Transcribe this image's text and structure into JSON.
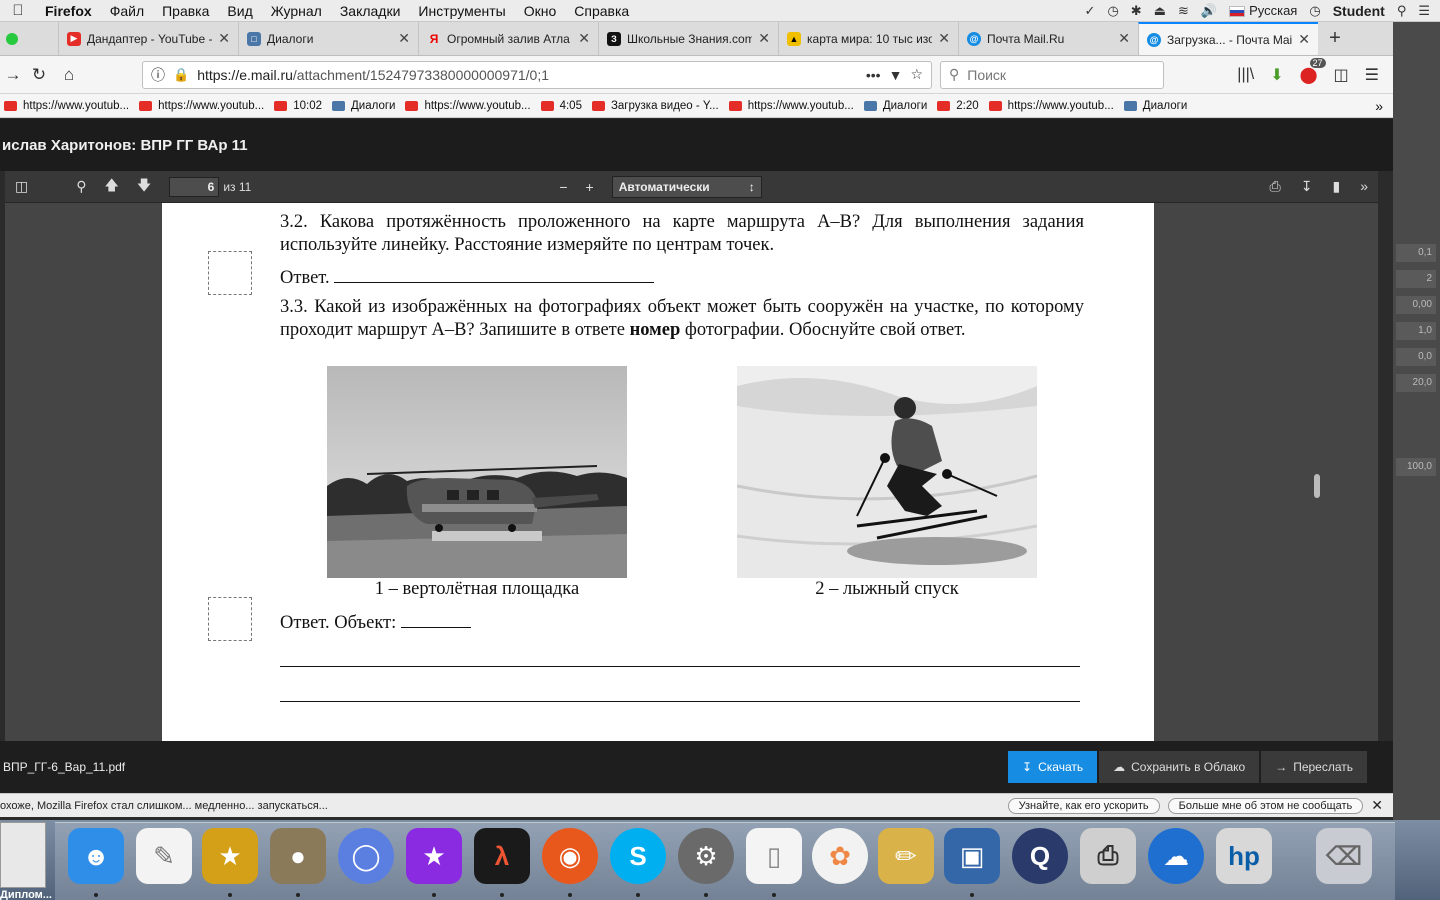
{
  "menubar": {
    "app": "Firefox",
    "items": [
      "Файл",
      "Правка",
      "Вид",
      "Журнал",
      "Закладки",
      "Инструменты",
      "Окно",
      "Справка"
    ],
    "language": "Русская",
    "user": "Student"
  },
  "tabs": [
    {
      "label": "Дандаптер - YouTube -",
      "icon": "youtube-icon"
    },
    {
      "label": "Диалоги",
      "icon": "vk-icon"
    },
    {
      "label": "Огромный залив Атла",
      "icon": "yandex-icon"
    },
    {
      "label": "Школьные Знания.com",
      "icon": "znania-icon"
    },
    {
      "label": "карта мира: 10 тыс изо",
      "icon": "image-icon"
    },
    {
      "label": "Почта Mail.Ru",
      "icon": "mail-icon"
    },
    {
      "label": "Загрузка... - Почта Mai",
      "icon": "mail-icon"
    }
  ],
  "url": {
    "host": "https://e.mail.ru",
    "path": "/attachment/15247973380000000971/0;1"
  },
  "search_placeholder": "Поиск",
  "library_badge": "27",
  "bookmarks": [
    {
      "label": "https://www.youtub...",
      "icon": "yt"
    },
    {
      "label": "https://www.youtub...",
      "icon": "yt"
    },
    {
      "label": "10:02",
      "icon": "yt"
    },
    {
      "label": "Диалоги",
      "icon": "vk"
    },
    {
      "label": "https://www.youtub...",
      "icon": "yt"
    },
    {
      "label": "4:05",
      "icon": "yt"
    },
    {
      "label": "Загрузка видео - Y...",
      "icon": "yt"
    },
    {
      "label": "https://www.youtub...",
      "icon": "yt"
    },
    {
      "label": "Диалоги",
      "icon": "vk"
    },
    {
      "label": "2:20",
      "icon": "yt"
    },
    {
      "label": "https://www.youtub...",
      "icon": "yt"
    },
    {
      "label": "Диалоги",
      "icon": "vk"
    }
  ],
  "attachment_title": "ислав Харитонов: ВПР ГГ ВАр 11",
  "viewer": {
    "page": "6",
    "page_count": "из 11",
    "zoom": "Автоматически"
  },
  "document": {
    "q32": "3.2. Какова протяжённость проложенного на карте маршрута А–В? Для выполнения задания используйте линейку. Расстояние измеряйте по центрам точек.",
    "answer1": "Ответ.",
    "q33_before": "3.3. Какой из изображённых на фотографиях объект может быть сооружён на участке, по которому проходит маршрут А–В? Запишите в ответе ",
    "q33_bold": "номер",
    "q33_after": " фотографии. Обоснуйте свой ответ.",
    "caption1": "1 – вертолётная площадка",
    "caption2": "2 – лыжный спуск",
    "answer2": "Ответ. Объект:"
  },
  "attachment_bar": {
    "filename": "ВПР_ГГ-6_Вар_11.pdf",
    "download": "Скачать",
    "save_cloud": "Сохранить в Облако",
    "forward": "Переслать"
  },
  "notification": {
    "text": "охоже, Mozilla Firefox стал слишком... медленно... запускаться...",
    "learn": "Узнайте, как его ускорить",
    "dismiss": "Больше мне об этом не сообщать"
  },
  "background_cells": [
    "0,1",
    "2",
    "0,00",
    "1,0",
    "0,0",
    "20,0",
    "100,0"
  ],
  "dock_label": "Диплом..."
}
